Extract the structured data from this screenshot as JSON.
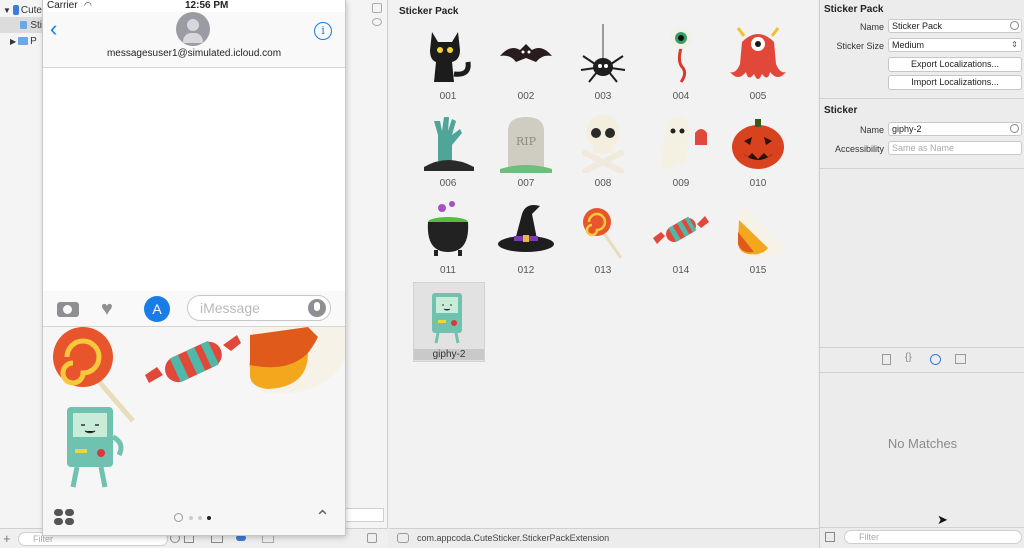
{
  "navigator": {
    "project_name": "Cute",
    "item_sticker": "Sti",
    "item_p": "P",
    "filter_placeholder": "Filter"
  },
  "simulator": {
    "carrier": "Carrier",
    "time": "12:56 PM",
    "contact": "messagesuser1@simulated.icloud.com",
    "compose_placeholder": "iMessage"
  },
  "canvas": {
    "title": "Sticker Pack",
    "stickers": [
      {
        "label": "001"
      },
      {
        "label": "002"
      },
      {
        "label": "003"
      },
      {
        "label": "004"
      },
      {
        "label": "005"
      },
      {
        "label": "006"
      },
      {
        "label": "007"
      },
      {
        "label": "008"
      },
      {
        "label": "009"
      },
      {
        "label": "010"
      },
      {
        "label": "011"
      },
      {
        "label": "012"
      },
      {
        "label": "013"
      },
      {
        "label": "014"
      },
      {
        "label": "015"
      },
      {
        "label": "giphy-2"
      }
    ],
    "tombstone_text": "RIP"
  },
  "bottom_bar": {
    "path": "com.appcoda.CuteSticker.StickerPackExtension"
  },
  "inspector": {
    "pack_section": "Sticker Pack",
    "name_label": "Name",
    "name_value": "Sticker Pack",
    "size_label": "Sticker Size",
    "size_value": "Medium",
    "export_button": "Export Localizations...",
    "import_button": "Import Localizations...",
    "sticker_section": "Sticker",
    "sticker_name_label": "Name",
    "sticker_name_value": "giphy-2",
    "accessibility_label": "Accessibility",
    "accessibility_placeholder": "Same as Name",
    "no_matches": "No Matches",
    "filter_placeholder": "Filter"
  },
  "colors": {
    "ios_blue": "#1a7ce6",
    "selection_gray": "#dcdcdc"
  }
}
